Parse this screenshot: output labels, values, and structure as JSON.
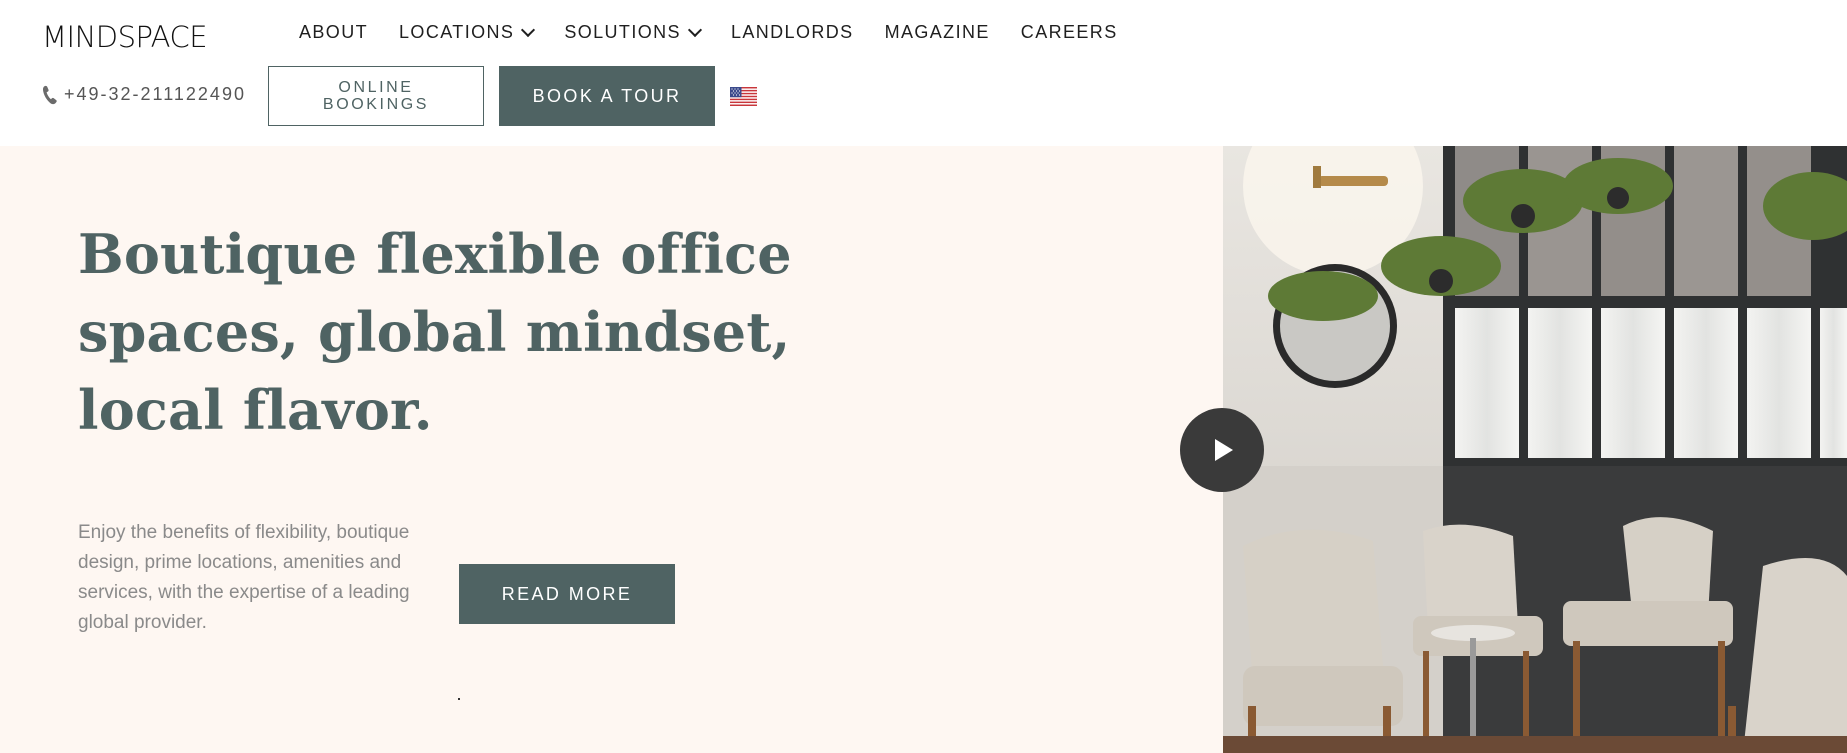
{
  "header": {
    "logo": "MINDSPACE",
    "nav": [
      {
        "label": "ABOUT",
        "dropdown": false
      },
      {
        "label": "LOCATIONS",
        "dropdown": true
      },
      {
        "label": "SOLUTIONS",
        "dropdown": true
      },
      {
        "label": "LANDLORDS",
        "dropdown": false
      },
      {
        "label": "MAGAZINE",
        "dropdown": false
      },
      {
        "label": "CAREERS",
        "dropdown": false
      }
    ],
    "phone": "+49-32-211122490",
    "online_bookings": "ONLINE BOOKINGS",
    "book_tour": "BOOK A TOUR",
    "language_flag": "us-flag-icon"
  },
  "hero": {
    "title": "Boutique flexible office spaces, global mindset, local flavor.",
    "body": "Enjoy the benefits of flexibility, boutique design, prime locations, amenities and services, with the expertise of a leading global provider.",
    "read_more": "READ MORE",
    "play_icon": "play-icon"
  },
  "colors": {
    "brand": "#4f6363",
    "hero_bg": "#fef7f2",
    "body_text": "#8a8a8a"
  }
}
